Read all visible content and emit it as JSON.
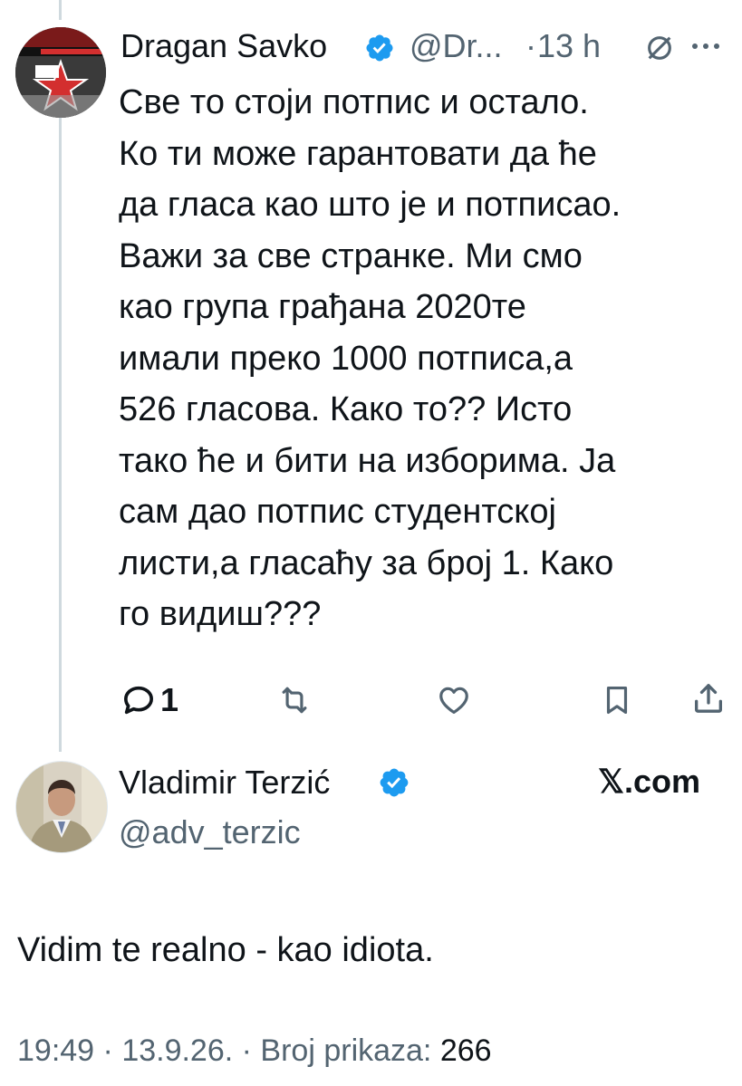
{
  "parent_tweet": {
    "author_name": "Dragan Savko",
    "handle": "@Dr...",
    "separator": "·",
    "time_ago": "13 h",
    "more_icon": "more-horizontal-icon",
    "verified": true,
    "lines": [
      "Све то стоји потпис и остало.",
      "Ко ти може гарантовати да ће",
      "да гласа као што је и потписао.",
      "Важи за све странке. Ми смо",
      "као група грађана 2020те",
      "имали преко 1000 потписа,а",
      "526 гласова. Како то?? Исто",
      "тако ће и бити на изборима. Ја",
      "сам дао потпис студентској",
      "листи,а гласаћу за број 1.  Како",
      "го видиш???"
    ],
    "actions": {
      "reply_count": "1"
    }
  },
  "reply_tweet": {
    "author_name": "Vladimir Terzić",
    "handle": "@adv_terzic",
    "verified": true,
    "watermark": "𝕏.com",
    "text": "Vidim te realno - kao idiota.",
    "meta": {
      "time": "19:49",
      "sep1": " · ",
      "date": "13.9.26.",
      "sep2": " · ",
      "views_label": "Broj prikaza: ",
      "views": "266"
    }
  },
  "colors": {
    "verified_blue": "#1d9bf0",
    "text": "#0f1419",
    "secondary": "#536471",
    "thread_line": "#cfd9de"
  }
}
